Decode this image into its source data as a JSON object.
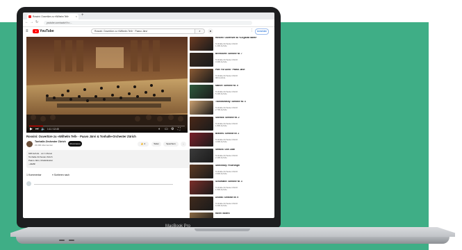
{
  "browser": {
    "tab_title": "Rossini: Ouvertüre zu «Wilhelm Tell»",
    "url": "youtube.com/watch?v=...",
    "tab_close": "×",
    "new_tab": "+"
  },
  "youtube": {
    "logo_text": "YouTube",
    "search_query": "Rossini: Ouvertüre zu «Wilhelm Tell» · Paavo Järvi",
    "sign_in": "Anmelden"
  },
  "player": {
    "time": "1:11 / 12:45",
    "progress": 0.09
  },
  "video": {
    "title": "Rossini: Ouvertüre zu «Wilhelm Tell» · Paavo Järvi & Tonhalle-Orchester Zürich",
    "channel": "Tonhalle-Orchester Zürich",
    "subscribers": "23.000 Abonnenten",
    "subscribe_label": "Abonnieren",
    "like_count": "2",
    "share_label": "Teilen",
    "save_label": "Speichern",
    "more_label": "..."
  },
  "description": {
    "line1": "648 Aufrufe · vor 1 Monat",
    "line2": "Tonhalle-Orchester Zürich",
    "line3": "Paavo Järvi, Musikdirektor",
    "line4": "...mehr"
  },
  "comments": {
    "count_label": "1 Kommentar",
    "sort_label": "Sortieren nach"
  },
  "recommendations": [
    {
      "title": "Rossini: Ouvertüre zu «La gazza ladra»",
      "channel": "Tonhalle-Orchester Zürich",
      "meta": "1.200 Aufrufe"
    },
    {
      "title": "Beethoven: Sinfonie Nr. 7",
      "channel": "Tonhalle-Orchester Zürich",
      "meta": "3.400 Aufrufe"
    },
    {
      "title": "Pärt: Für Alina · Paavo Järvi",
      "channel": "Tonhalle-Orchester Zürich",
      "meta": "900 Aufrufe"
    },
    {
      "title": "Mahler: Sinfonie Nr. 5",
      "channel": "Tonhalle-Orchester Zürich",
      "meta": "5.100 Aufrufe"
    },
    {
      "title": "Tschaikowsky: Sinfonie Nr. 4",
      "channel": "Tonhalle-Orchester Zürich",
      "meta": "2.700 Aufrufe"
    },
    {
      "title": "Sibelius: Sinfonie Nr. 2",
      "channel": "Tonhalle-Orchester Zürich",
      "meta": "1.800 Aufrufe"
    },
    {
      "title": "Brahms: Sinfonie Nr. 1",
      "channel": "Tonhalle-Orchester Zürich",
      "meta": "4.300 Aufrufe"
    },
    {
      "title": "Strauss: Don Juan",
      "channel": "Tonhalle-Orchester Zürich",
      "meta": "2.100 Aufrufe"
    },
    {
      "title": "Stravinsky: Feuervogel",
      "channel": "Tonhalle-Orchester Zürich",
      "meta": "3.900 Aufrufe"
    },
    {
      "title": "Schumann: Sinfonie Nr. 3",
      "channel": "Tonhalle-Orchester Zürich",
      "meta": "1.500 Aufrufe"
    },
    {
      "title": "Dvořák: Sinfonie Nr. 9",
      "channel": "Tonhalle-Orchester Zürich",
      "meta": "6.200 Aufrufe"
    },
    {
      "title": "Ravel: Boléro",
      "channel": "Tonhalle-Orchester Zürich",
      "meta": "8.000 Aufrufe"
    }
  ],
  "laptop": {
    "brand": "MacBook Pro"
  },
  "colors": {
    "background_green": "#3fae86",
    "youtube_red": "#ff0000",
    "bezel": "#1d1e20"
  }
}
